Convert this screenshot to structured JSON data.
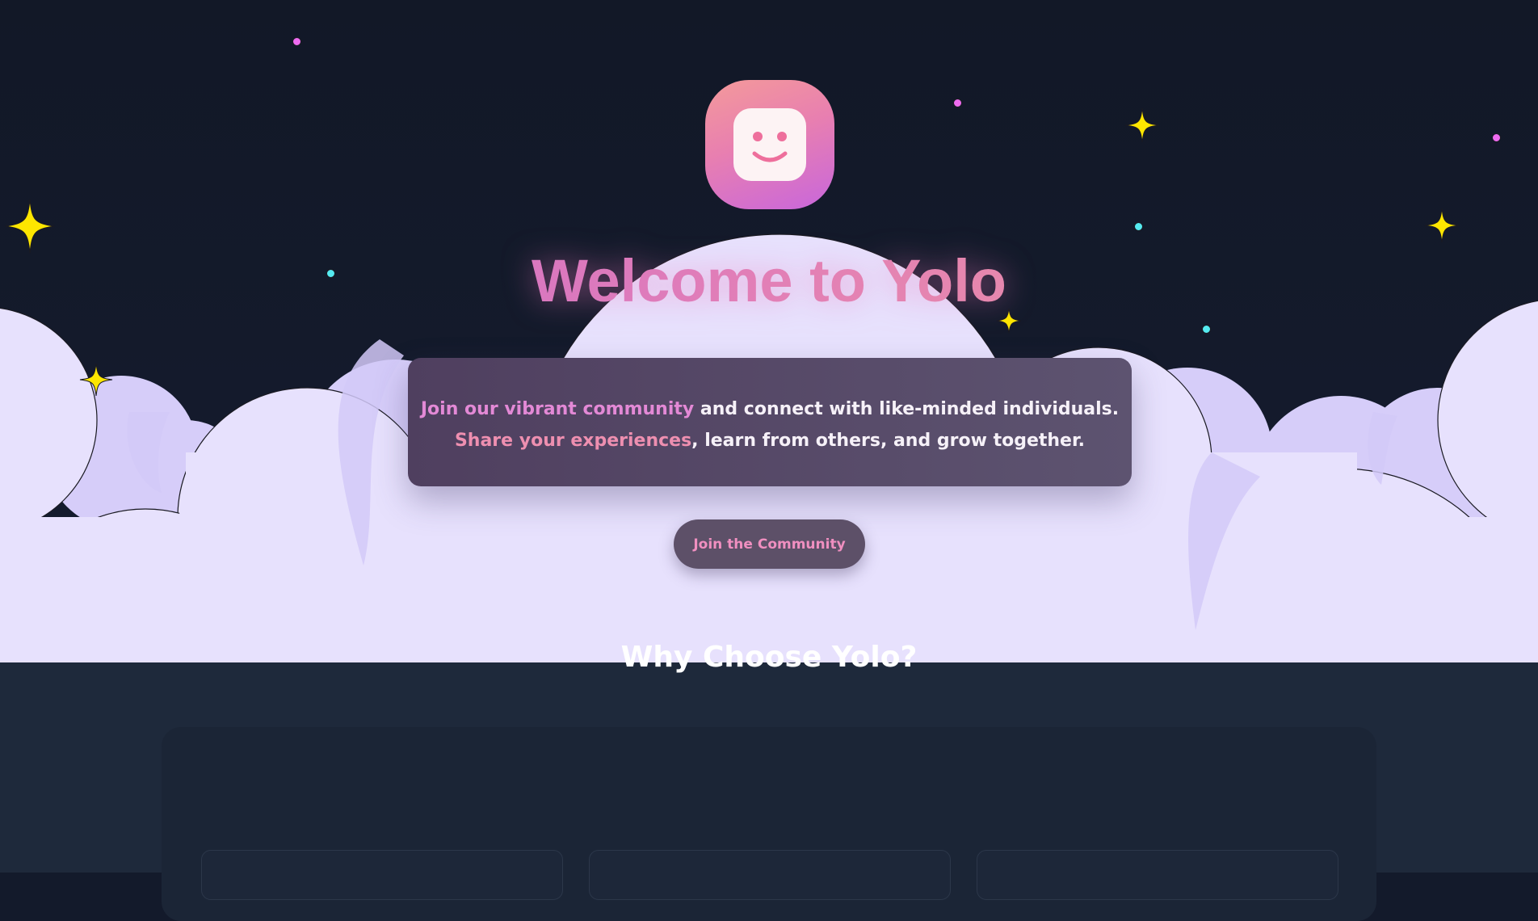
{
  "hero": {
    "title": "Welcome to Yolo",
    "tagline": {
      "line1_highlight": "Join our vibrant community",
      "line1_rest": " and connect with like-minded individuals.",
      "line2_highlight": "Share your experiences",
      "line2_rest": ", learn from others, and grow together."
    },
    "cta_label": "Join the Community"
  },
  "features": {
    "title": "Why Choose Yolo?"
  },
  "colors": {
    "background": "#121827",
    "cloud": "#e7e1fd",
    "cloud_shade": "#d2c9f8",
    "accent_pink": "#e87fb0",
    "accent_purple": "#c866dc",
    "star_yellow": "#fde600",
    "section_bg": "#1e293b"
  },
  "icons": {
    "logo": "smiley-face-icon",
    "stars": "sparkle-star-icon",
    "dots": "dot-icon"
  }
}
